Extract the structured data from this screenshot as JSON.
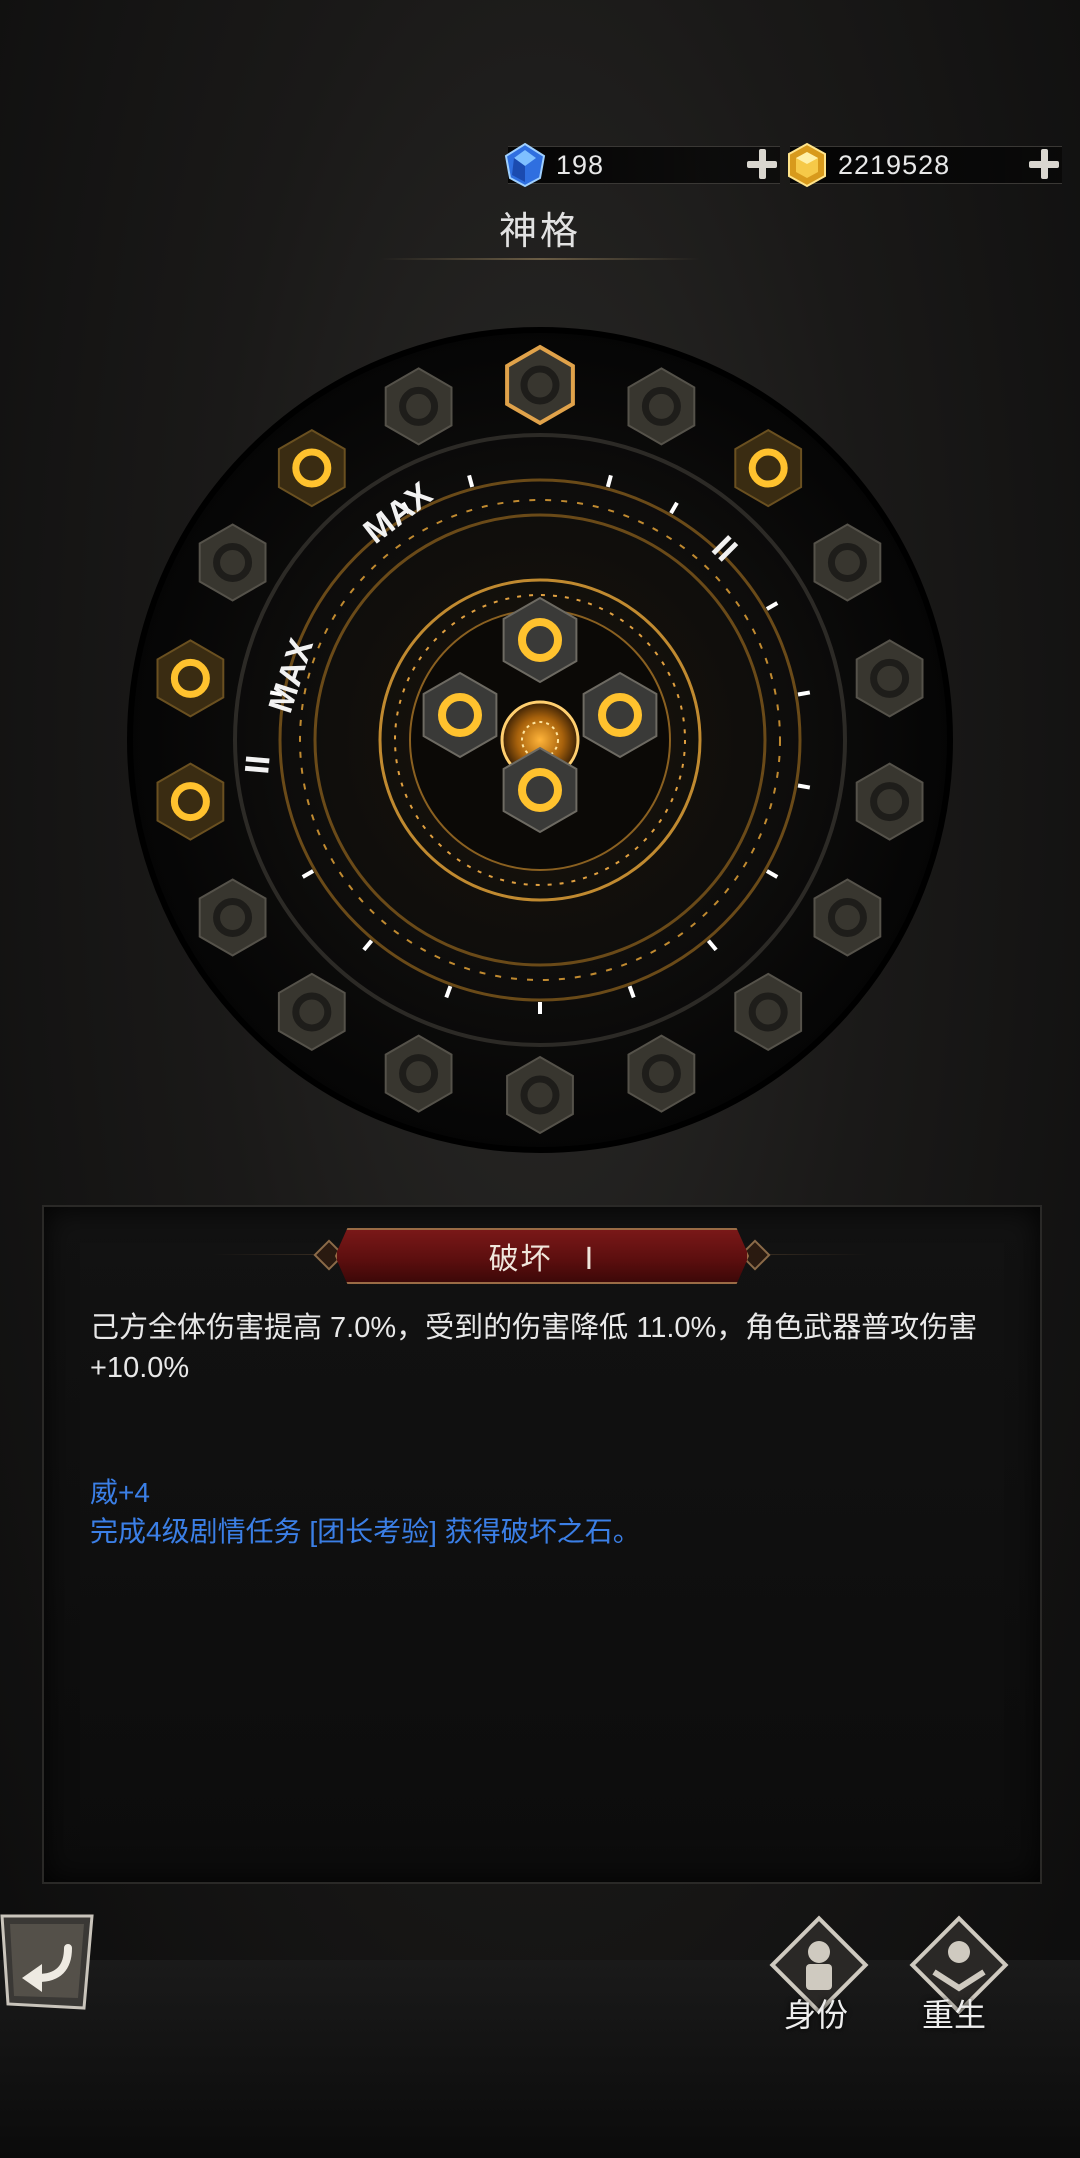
{
  "currency": {
    "gems": {
      "icon": "blue-gem-icon",
      "value": "198"
    },
    "gold": {
      "icon": "gold-gem-icon",
      "value": "2219528"
    }
  },
  "header": {
    "title": "神格"
  },
  "wheel": {
    "outer_markers": [
      "MAX",
      "MAX",
      "II",
      "II",
      "I"
    ],
    "center": {
      "top": "moon-rune-icon",
      "left": "flame-rune-icon",
      "right": "hourglass-rune-icon",
      "bottom": "ghost-rune-icon",
      "core": "core-sigil-icon"
    },
    "runes": [
      {
        "name": "destruction-rune-icon",
        "active": false,
        "selected": true
      },
      {
        "name": "shatter-rune-icon",
        "active": false
      },
      {
        "name": "flame-rune-icon",
        "active": true
      },
      {
        "name": "triangle-rune-icon",
        "active": false
      },
      {
        "name": "rock-rune-icon",
        "active": false
      },
      {
        "name": "tree-rune-icon",
        "active": false
      },
      {
        "name": "spike-rune-icon",
        "active": false
      },
      {
        "name": "arrow-rune-icon",
        "active": false
      },
      {
        "name": "axe-rune-icon",
        "active": false
      },
      {
        "name": "mountain-rune-icon",
        "active": false
      },
      {
        "name": "claw-rune-icon",
        "active": false
      },
      {
        "name": "wave-rune-icon",
        "active": false
      },
      {
        "name": "shield-rune-icon",
        "active": false
      },
      {
        "name": "hourglass-rune-icon",
        "active": true
      },
      {
        "name": "ghost-rune-icon",
        "active": true
      },
      {
        "name": "sun-rune-icon",
        "active": false
      },
      {
        "name": "moon-rune-icon",
        "active": true
      },
      {
        "name": "star-rune-icon",
        "active": false
      }
    ]
  },
  "panel": {
    "banner": "破坏　Ⅰ",
    "description": "己方全体伤害提高 7.0%，受到的伤害降低 11.0%，角色武器普攻伤害+10.0%",
    "requirement": "威+4",
    "hint": "完成4级剧情任务 [团长考验] 获得破坏之石。"
  },
  "bottom": {
    "back": "back-arrow-icon",
    "identity_label": "身份",
    "rebirth_label": "重生"
  }
}
